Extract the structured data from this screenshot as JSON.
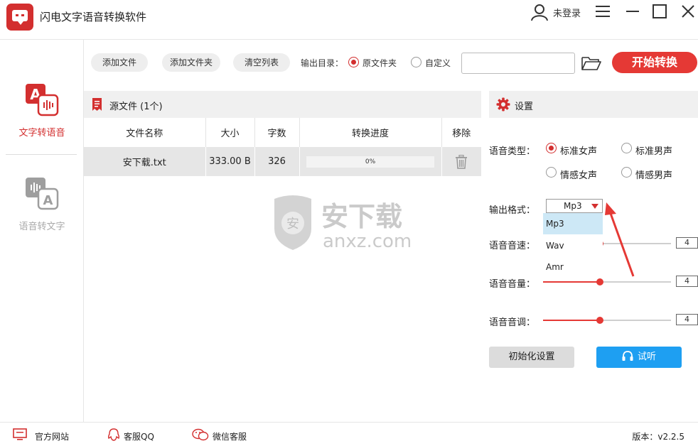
{
  "app": {
    "title": "闪电文字语音转换软件"
  },
  "titlebar": {
    "user_label": "未登录"
  },
  "sidebar": {
    "items": [
      {
        "label": "文字转语音",
        "active": true
      },
      {
        "label": "语音转文字",
        "active": false
      }
    ]
  },
  "toolbar": {
    "add_file": "添加文件",
    "add_folder": "添加文件夹",
    "clear_list": "清空列表",
    "output_dir_label": "输出目录：",
    "radio_source": "原文件夹",
    "radio_custom": "自定义",
    "path_value": "",
    "start": "开始转换"
  },
  "files": {
    "header": "源文件 (1个)",
    "columns": [
      "文件名称",
      "大小",
      "字数",
      "转换进度",
      "移除"
    ],
    "rows": [
      {
        "name": "安下载.txt",
        "size": "333.00 B",
        "words": "326",
        "progress": "0%"
      }
    ]
  },
  "watermark": {
    "cn": "安下载",
    "en": "anxz.com",
    "badge": "安"
  },
  "settings": {
    "header": "设置",
    "voice_type_label": "语音类型：",
    "voices": [
      "标准女声",
      "标准男声",
      "情感女声",
      "情感男声"
    ],
    "selected_voice": "标准女声",
    "format_label": "输出格式：",
    "format_value": "Mp3",
    "format_options": [
      "Mp3",
      "Wav",
      "Amr"
    ],
    "speed_label": "语音音速：",
    "speed_value": "4",
    "volume_label": "语音音量：",
    "volume_value": "4",
    "pitch_label": "语音音调：",
    "pitch_value": "4",
    "reset": "初始化设置",
    "listen": "试听"
  },
  "footer": {
    "website": "官方网站",
    "qq": "客服QQ",
    "wechat": "微信客服",
    "version": "版本：v2.2.5"
  },
  "colors": {
    "accent": "#d32f2f",
    "button_red": "#e53935",
    "button_blue": "#1e9ff2",
    "selection": "#cde8f6"
  }
}
